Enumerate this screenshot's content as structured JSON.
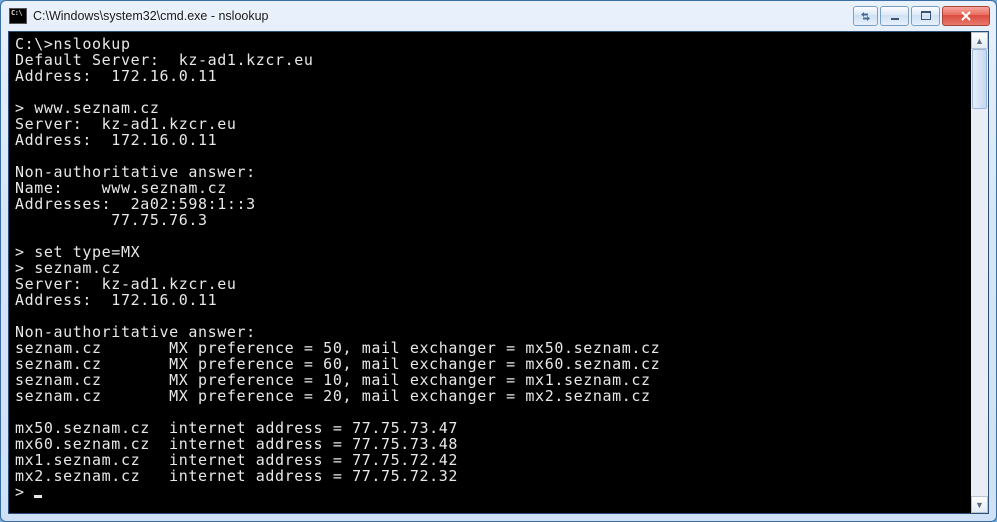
{
  "window": {
    "title": "C:\\Windows\\system32\\cmd.exe - nslookup"
  },
  "terminal": {
    "lines": [
      "C:\\>nslookup",
      "Default Server:  kz-ad1.kzcr.eu",
      "Address:  172.16.0.11",
      "",
      "> www.seznam.cz",
      "Server:  kz-ad1.kzcr.eu",
      "Address:  172.16.0.11",
      "",
      "Non-authoritative answer:",
      "Name:    www.seznam.cz",
      "Addresses:  2a02:598:1::3",
      "          77.75.76.3",
      "",
      "> set type=MX",
      "> seznam.cz",
      "Server:  kz-ad1.kzcr.eu",
      "Address:  172.16.0.11",
      "",
      "Non-authoritative answer:",
      "seznam.cz       MX preference = 50, mail exchanger = mx50.seznam.cz",
      "seznam.cz       MX preference = 60, mail exchanger = mx60.seznam.cz",
      "seznam.cz       MX preference = 10, mail exchanger = mx1.seznam.cz",
      "seznam.cz       MX preference = 20, mail exchanger = mx2.seznam.cz",
      "",
      "mx50.seznam.cz  internet address = 77.75.73.47",
      "mx60.seznam.cz  internet address = 77.75.73.48",
      "mx1.seznam.cz   internet address = 77.75.72.42",
      "mx2.seznam.cz   internet address = 77.75.72.32",
      "> "
    ]
  }
}
